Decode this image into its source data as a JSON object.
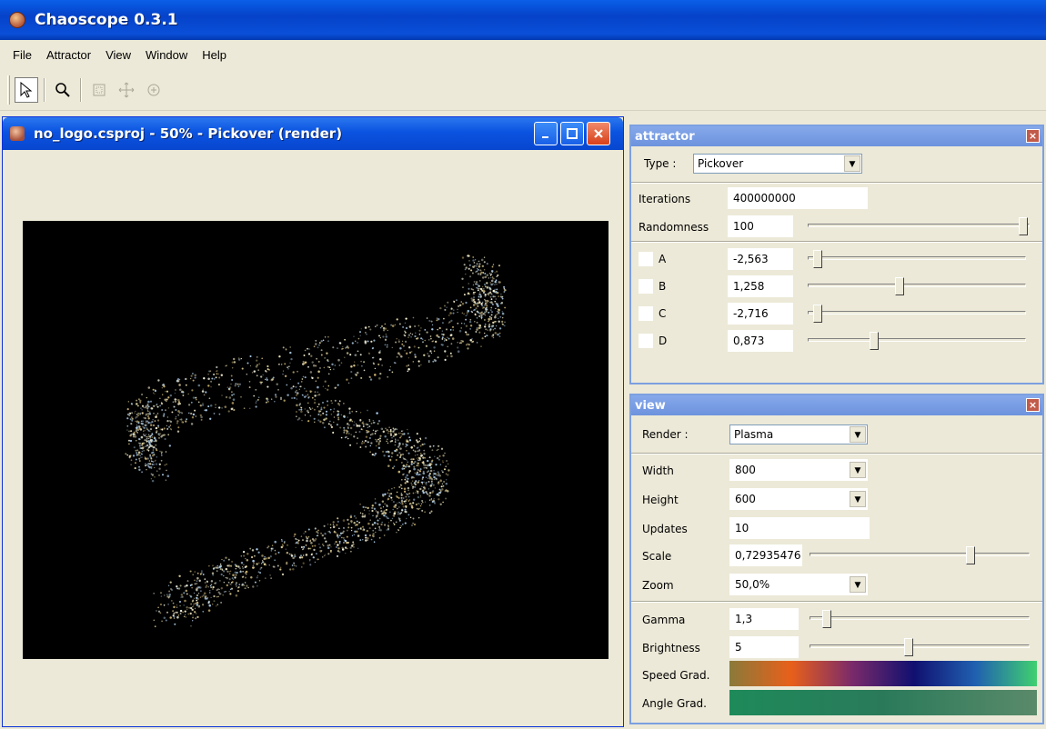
{
  "app": {
    "title": "Chaoscope 0.3.1"
  },
  "menu": [
    "File",
    "Attractor",
    "View",
    "Window",
    "Help"
  ],
  "child_window": {
    "title": "no_logo.csproj - 50% - Pickover (render)"
  },
  "attractor_panel": {
    "title": "attractor",
    "type_label": "Type :",
    "type_value": "Pickover",
    "iterations_label": "Iterations",
    "iterations_value": "400000000",
    "randomness_label": "Randomness",
    "randomness_value": "100",
    "params": [
      {
        "name": "A",
        "value": "-2,563"
      },
      {
        "name": "B",
        "value": "1,258"
      },
      {
        "name": "C",
        "value": "-2,716"
      },
      {
        "name": "D",
        "value": "0,873"
      }
    ]
  },
  "view_panel": {
    "title": "view",
    "render_label": "Render :",
    "render_value": "Plasma",
    "width_label": "Width",
    "width_value": "800",
    "height_label": "Height",
    "height_value": "600",
    "updates_label": "Updates",
    "updates_value": "10",
    "scale_label": "Scale",
    "scale_value": "0,72935476",
    "zoom_label": "Zoom",
    "zoom_value": "50,0%",
    "gamma_label": "Gamma",
    "gamma_value": "1,3",
    "brightness_label": "Brightness",
    "brightness_value": "5",
    "speed_grad_label": "Speed Grad.",
    "angle_grad_label": "Angle Grad."
  },
  "colors": {
    "speed_gradient": [
      "#8a7a3a",
      "#e8601a",
      "#7a2a6a",
      "#101070",
      "#2060b0",
      "#40d070"
    ],
    "angle_gradient": [
      "#1e8a5a",
      "#2a7a5a",
      "#5a8a6a"
    ]
  }
}
